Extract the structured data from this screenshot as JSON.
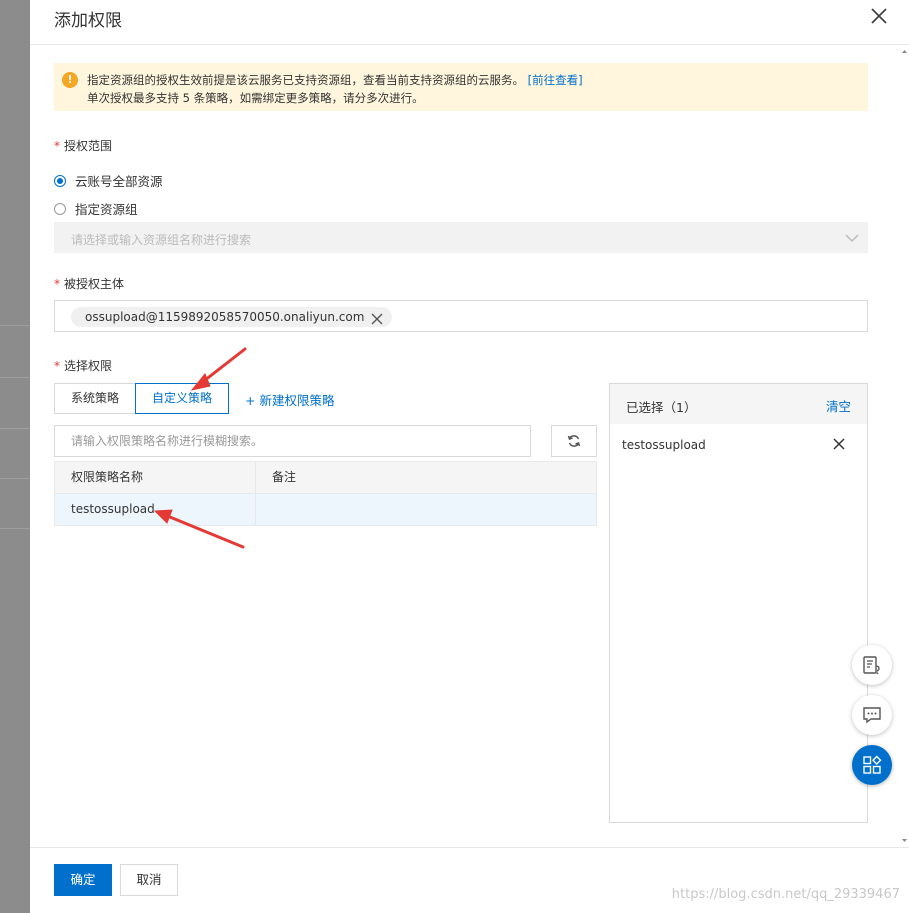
{
  "dialog": {
    "title": "添加权限"
  },
  "alert": {
    "line1": "指定资源组的授权生效前提是该云服务已支持资源组，查看当前支持资源组的云服务。",
    "link": "[前往查看]",
    "line2": "单次授权最多支持 5 条策略，如需绑定更多策略，请分多次进行。"
  },
  "scope": {
    "label": "授权范围",
    "required_mark": "*",
    "options": [
      {
        "label": "云账号全部资源",
        "checked": true
      },
      {
        "label": "指定资源组",
        "checked": false
      }
    ],
    "select_placeholder": "请选择或输入资源组名称进行搜索"
  },
  "principal": {
    "label": "被授权主体",
    "required_mark": "*",
    "tag": "ossupload@1159892058570050.onaliyun.com"
  },
  "permissions": {
    "label": "选择权限",
    "required_mark": "*",
    "tabs": [
      {
        "label": "系统策略",
        "active": false
      },
      {
        "label": "自定义策略",
        "active": true
      }
    ],
    "new_policy_label": "+ 新建权限策略",
    "search_placeholder": "请输入权限策略名称进行模糊搜索。",
    "table": {
      "columns": [
        "权限策略名称",
        "备注"
      ],
      "rows": [
        {
          "name": "testossupload",
          "note": ""
        }
      ]
    }
  },
  "selected": {
    "title": "已选择（1）",
    "clear_label": "清空",
    "items": [
      "testossupload"
    ]
  },
  "footer": {
    "confirm_label": "确定",
    "cancel_label": "取消",
    "watermark": "https://blog.csdn.net/qq_29339467"
  },
  "colors": {
    "primary": "#0070cc",
    "alert_bg": "#fff6dd",
    "warning": "#f5a623",
    "annotation": "#e53935"
  },
  "icons": {
    "close": "close-icon",
    "warning": "warning-icon",
    "chevron": "chevron-down-icon",
    "refresh": "refresh-icon",
    "remove": "remove-icon",
    "feedback": "feedback-icon",
    "chat": "chat-icon",
    "apps": "apps-icon"
  }
}
